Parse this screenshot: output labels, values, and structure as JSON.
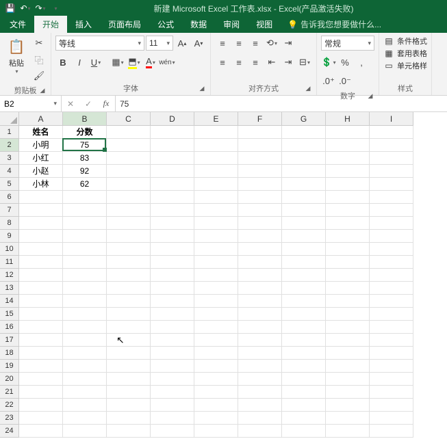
{
  "titlebar": {
    "title": "新建 Microsoft Excel 工作表.xlsx - Excel(产品激活失败)"
  },
  "tabs": {
    "file": "文件",
    "home": "开始",
    "insert": "插入",
    "layout": "页面布局",
    "formula": "公式",
    "data": "数据",
    "review": "审阅",
    "view": "视图",
    "tellme": "告诉我您想要做什么..."
  },
  "ribbon": {
    "clipboard": {
      "paste": "粘贴",
      "label": "剪贴板"
    },
    "font": {
      "name": "等线",
      "size": "11",
      "label": "字体"
    },
    "align": {
      "label": "对齐方式"
    },
    "number": {
      "format": "常规",
      "label": "数字"
    },
    "styles": {
      "cond": "条件格式",
      "table": "套用表格",
      "cell": "单元格样",
      "label": "样式"
    }
  },
  "formula": {
    "cellref": "B2",
    "value": "75"
  },
  "grid": {
    "cols": [
      "A",
      "B",
      "C",
      "D",
      "E",
      "F",
      "G",
      "H",
      "I"
    ],
    "activeColIdx": 1,
    "activeRow": 2,
    "rows": 24,
    "data": [
      [
        "姓名",
        "分数",
        "",
        "",
        "",
        "",
        "",
        "",
        ""
      ],
      [
        "小明",
        "75",
        "",
        "",
        "",
        "",
        "",
        "",
        ""
      ],
      [
        "小红",
        "83",
        "",
        "",
        "",
        "",
        "",
        "",
        ""
      ],
      [
        "小赵",
        "92",
        "",
        "",
        "",
        "",
        "",
        "",
        ""
      ],
      [
        "小林",
        "62",
        "",
        "",
        "",
        "",
        "",
        "",
        ""
      ]
    ]
  },
  "chart_data": {
    "type": "table",
    "title": "",
    "columns": [
      "姓名",
      "分数"
    ],
    "rows": [
      {
        "姓名": "小明",
        "分数": 75
      },
      {
        "姓名": "小红",
        "分数": 83
      },
      {
        "姓名": "小赵",
        "分数": 92
      },
      {
        "姓名": "小林",
        "分数": 62
      }
    ]
  }
}
